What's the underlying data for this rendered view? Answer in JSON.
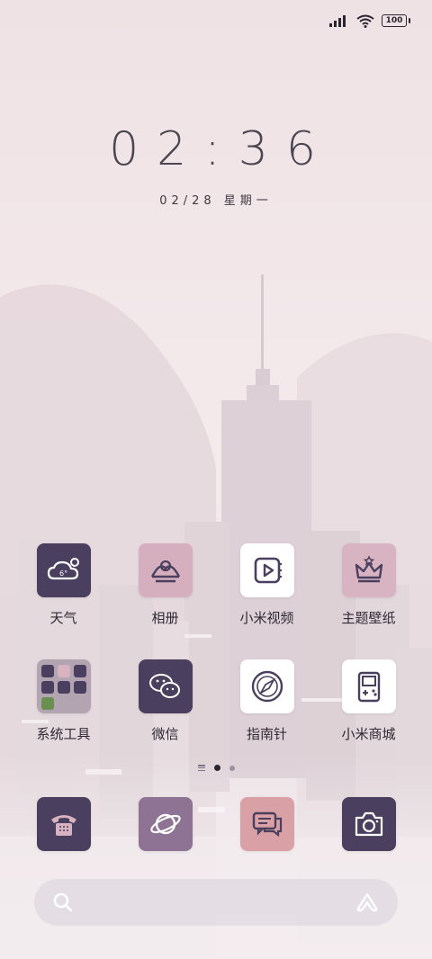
{
  "status": {
    "battery": "100"
  },
  "lock": {
    "time": "02:36",
    "date": "02/28 星期一"
  },
  "apps_row1": [
    {
      "label": "天气",
      "icon": "weather-icon",
      "bg": "#4a3f5e",
      "badge": "6°"
    },
    {
      "label": "相册",
      "icon": "gallery-icon",
      "bg": "#d5afbd"
    },
    {
      "label": "小米视频",
      "icon": "video-icon",
      "bg": "#ffffff"
    },
    {
      "label": "主题壁纸",
      "icon": "crown-icon",
      "bg": "#d8b4c2"
    }
  ],
  "apps_row2": [
    {
      "label": "系统工具",
      "icon": "folder-icon"
    },
    {
      "label": "微信",
      "icon": "wechat-icon",
      "bg": "#4a3f5e"
    },
    {
      "label": "指南针",
      "icon": "compass-icon",
      "bg": "#ffffff"
    },
    {
      "label": "小米商城",
      "icon": "gameboy-icon",
      "bg": "#ffffff"
    }
  ],
  "dock": [
    {
      "icon": "phone-icon",
      "bg": "#4a3f5e"
    },
    {
      "icon": "browser-icon",
      "bg": "#8e7394"
    },
    {
      "icon": "messages-icon",
      "bg": "#d9a0a5"
    },
    {
      "icon": "camera-icon",
      "bg": "#4a3f5e"
    }
  ],
  "colors": {
    "dark": "#4a3f5e",
    "pink": "#d5afbd",
    "accent_pink": "#d9a0a5"
  }
}
